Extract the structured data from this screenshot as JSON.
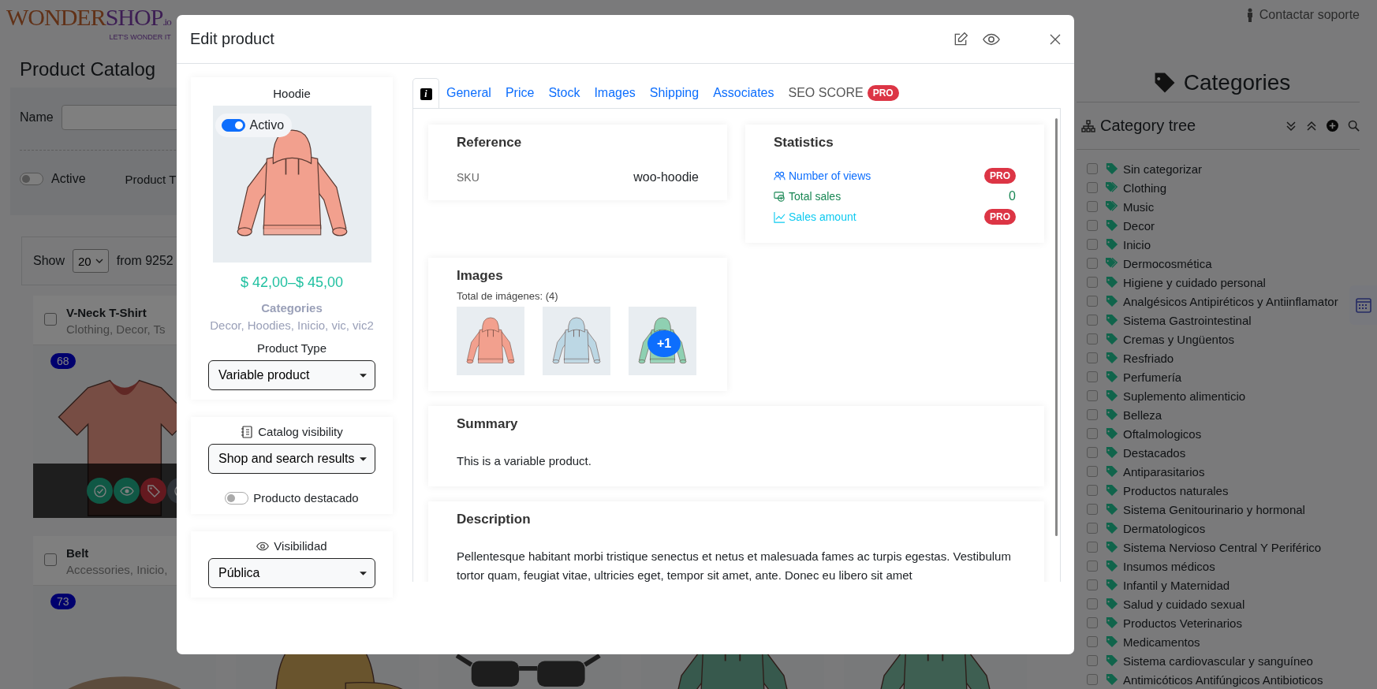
{
  "header": {
    "logo_first": "WONDER",
    "logo_second": "SHOP",
    "logo_suffix": ".io",
    "tagline": "LET'S WONDER IT",
    "support_link": "Contactar soporte"
  },
  "catalog": {
    "title": "Product Catalog",
    "filters": {
      "name_label": "Name",
      "active_label": "Active",
      "active_on": false,
      "product_type_label": "Product T"
    },
    "pager": {
      "show_label": "Show",
      "page_size": "20",
      "total": "from 9252"
    },
    "products": [
      {
        "name": "V-Neck T-Shirt",
        "categories": "Clothing, Decor, Ts",
        "badge": "68",
        "checked": false,
        "actions": [
          {
            "kind": "approve"
          },
          {
            "kind": "view"
          },
          {
            "kind": "tags"
          },
          {
            "kind": "colors"
          }
        ]
      },
      {
        "name": "Belt",
        "categories": "Accessories, Inicio,",
        "badge": "73",
        "checked": false
      }
    ],
    "more_cards": [
      {
        "kind": "picture"
      },
      {
        "kind": "picture"
      },
      {
        "kind": "picture"
      },
      {
        "kind": "picture"
      }
    ]
  },
  "categories_panel": {
    "title": "Categories",
    "tree_title": "Category tree",
    "items": [
      {
        "label": "Sin categorizar",
        "kind": "tag",
        "checked": false
      },
      {
        "label": "Clothing",
        "kind": "tags",
        "checked": false
      },
      {
        "label": "Music",
        "kind": "tags",
        "checked": false
      },
      {
        "label": "Decor",
        "kind": "tag",
        "checked": false
      },
      {
        "label": "Inicio",
        "kind": "tag",
        "checked": false
      },
      {
        "label": "Dermocosmética",
        "kind": "tags",
        "checked": false
      },
      {
        "label": "Higiene y cuidado personal",
        "kind": "tag",
        "checked": false
      },
      {
        "label": "Analgésicos Antipiréticos y Antiinflamator",
        "kind": "tag",
        "checked": false
      },
      {
        "label": "Sistema Gastrointestinal",
        "kind": "tag",
        "checked": false
      },
      {
        "label": "Cremas y Ungüentos",
        "kind": "tag",
        "checked": false
      },
      {
        "label": "Resfriado",
        "kind": "tag",
        "checked": false
      },
      {
        "label": "Perfumería",
        "kind": "tag",
        "checked": false
      },
      {
        "label": "Suplemento alimenticio",
        "kind": "tag",
        "checked": false
      },
      {
        "label": "Belleza",
        "kind": "tag",
        "checked": false
      },
      {
        "label": "Oftalmologicos",
        "kind": "tag",
        "checked": false
      },
      {
        "label": "Destacados",
        "kind": "tag",
        "checked": false
      },
      {
        "label": "Antiparasitarios",
        "kind": "tag",
        "checked": false
      },
      {
        "label": "Productos naturales",
        "kind": "tag",
        "checked": false
      },
      {
        "label": "Sistema Genitourinario y hormonal",
        "kind": "tag",
        "checked": false
      },
      {
        "label": "Dermatologicos",
        "kind": "tag",
        "checked": false
      },
      {
        "label": "Sistema Nervioso Central Y Periférico",
        "kind": "tag",
        "checked": false
      },
      {
        "label": "Insumos médicos",
        "kind": "tag",
        "checked": false
      },
      {
        "label": "Infantil y Maternidad",
        "kind": "tag",
        "checked": false
      },
      {
        "label": "Salud y cuidado sexual",
        "kind": "tag",
        "checked": false
      },
      {
        "label": "Productos Veterinarios",
        "kind": "tag",
        "checked": false
      },
      {
        "label": "Medicamentos",
        "kind": "tag",
        "checked": false
      },
      {
        "label": "Sistema cardiovascular y sanguíneo",
        "kind": "tag",
        "checked": false
      },
      {
        "label": "Antimicóticos Antifúngicos Antibioticos",
        "kind": "tag",
        "checked": false
      }
    ]
  },
  "modal": {
    "title": "Edit product",
    "product": {
      "name": "Hoodie",
      "active_label": "Activo",
      "active": true,
      "price": "$ 42,00–$ 45,00",
      "categories_label": "Categories",
      "categories": "Decor, Hoodies, Inicio, vic, vic2",
      "type_label": "Product Type",
      "type": "Variable product"
    },
    "catalog_visibility": {
      "label": "Catalog visibility",
      "value": "Shop and search results",
      "featured_label": "Producto destacado",
      "featured": false
    },
    "visibility": {
      "label": "Visibilidad",
      "value": "Pública"
    },
    "tabs": [
      {
        "kind": "icon",
        "label": "i",
        "selected": true,
        "disabled": false
      },
      {
        "kind": "text",
        "label": "General",
        "selected": false,
        "disabled": false
      },
      {
        "kind": "text",
        "label": "Price",
        "selected": false,
        "disabled": false
      },
      {
        "kind": "text",
        "label": "Stock",
        "selected": false,
        "disabled": false
      },
      {
        "kind": "text",
        "label": "Images",
        "selected": false,
        "disabled": false
      },
      {
        "kind": "text",
        "label": "Shipping",
        "selected": false,
        "disabled": false
      },
      {
        "kind": "text",
        "label": "Associates",
        "selected": false,
        "disabled": false
      },
      {
        "kind": "text",
        "label": "SEO SCORE",
        "badge": "PRO",
        "selected": false,
        "disabled": true
      }
    ],
    "reference": {
      "title": "Reference",
      "rows": [
        {
          "label": "SKU",
          "value": "woo-hoodie"
        }
      ]
    },
    "statistics": {
      "title": "Statistics",
      "rows": [
        {
          "kind": "views",
          "label": "Number of views",
          "badge": "PRO"
        },
        {
          "kind": "sales",
          "label": "Total sales",
          "value": "0"
        },
        {
          "kind": "amount",
          "label": "Sales amount",
          "badge": "PRO"
        }
      ]
    },
    "images": {
      "title": "Images",
      "count_label": "Total de imágenes: (4)",
      "thumbs": [
        {
          "kind": "picture"
        },
        {
          "kind": "picture"
        },
        {
          "kind": "picture",
          "more": "+1"
        }
      ]
    },
    "summary": {
      "title": "Summary",
      "text": "This is a variable product."
    },
    "description": {
      "title": "Description",
      "text": "Pellentesque habitant morbi tristique senectus et netus et malesuada fames ac turpis egestas. Vestibulum tortor quam, feugiat vitae, ultricies eget, tempor sit amet, ante. Donec eu libero sit amet"
    }
  }
}
